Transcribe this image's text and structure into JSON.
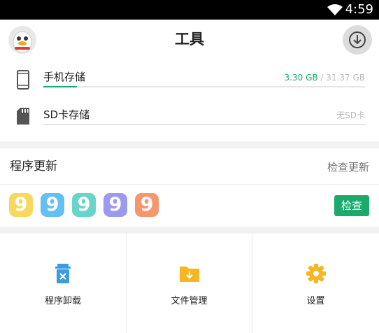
{
  "status_bar": {
    "time": "4:59",
    "wifi_icon": "wifi-icon"
  },
  "header": {
    "title": "工具",
    "avatar_icon": "penguin-avatar",
    "download_icon": "download-icon"
  },
  "storage": [
    {
      "label": "手机存储",
      "used": "3.30 GB",
      "total": " / 31.37 GB",
      "fraction": 0.105,
      "icon": "phone-icon"
    },
    {
      "label": "SD卡存储",
      "used": "",
      "total": "无SD卡",
      "fraction": 0,
      "icon": "sd-card-icon"
    }
  ],
  "update": {
    "title": "程序更新",
    "check_link": "检查更新",
    "check_button": "检查",
    "app_icons": [
      {
        "name": "app-icon-yellow",
        "color": "#f8d85c",
        "glyph": "9"
      },
      {
        "name": "app-icon-blue",
        "color": "#64c0f2",
        "glyph": "9"
      },
      {
        "name": "app-icon-teal",
        "color": "#69d4c8",
        "glyph": "9"
      },
      {
        "name": "app-icon-purple",
        "color": "#9b9af0",
        "glyph": "9"
      },
      {
        "name": "app-icon-orange",
        "color": "#f7956d",
        "glyph": "9"
      }
    ]
  },
  "tools": [
    {
      "label": "程序卸载",
      "icon": "trash-icon",
      "color": "#3b9be3"
    },
    {
      "label": "文件管理",
      "icon": "folder-icon",
      "color": "#f6b621"
    },
    {
      "label": "设置",
      "icon": "gear-icon",
      "color": "#f6b621"
    }
  ],
  "colors": {
    "accent": "#1aab6a",
    "muted": "#bbbbbb"
  }
}
